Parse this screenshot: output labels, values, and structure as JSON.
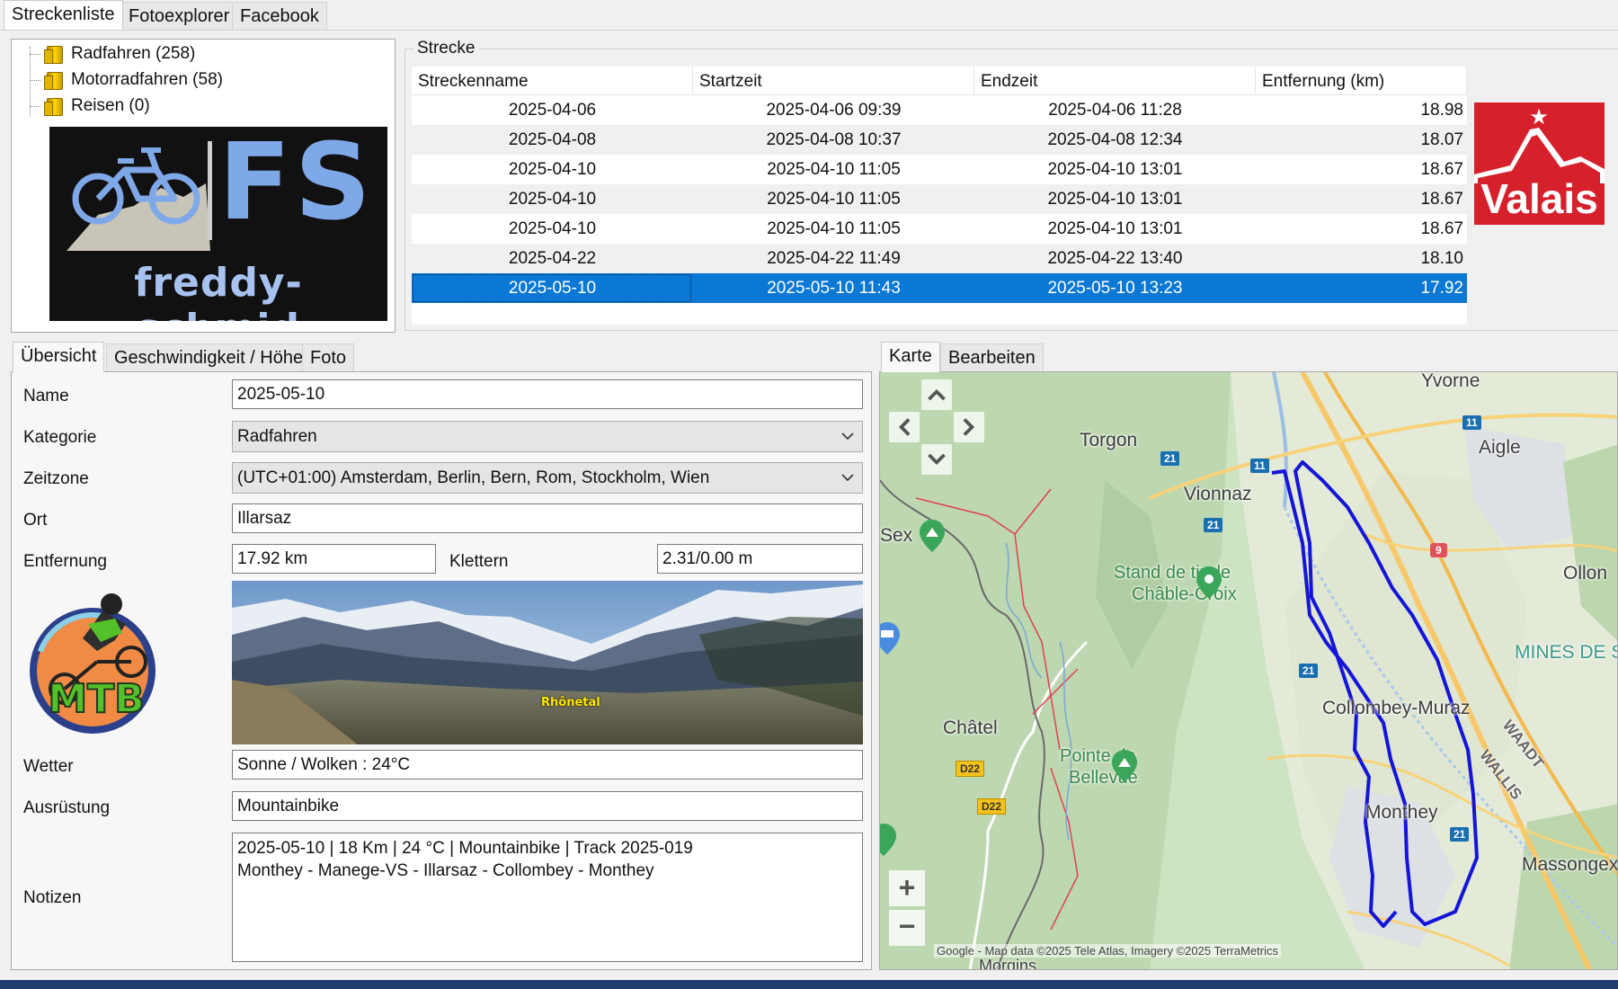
{
  "top_tabs": [
    "Streckenliste",
    "Fotoexplorer",
    "Facebook"
  ],
  "tree": [
    {
      "label": "Radfahren (258)"
    },
    {
      "label": "Motorradfahren (58)"
    },
    {
      "label": "Reisen (0)"
    }
  ],
  "logo_fs": {
    "main": "FS",
    "sub": "freddy-schmid"
  },
  "strecke": {
    "legend": "Strecke",
    "columns": [
      "Streckenname",
      "Startzeit",
      "Endzeit",
      "Entfernung (km)"
    ],
    "rows": [
      {
        "name": "2025-04-06",
        "start": "2025-04-06 09:39",
        "end": "2025-04-06 11:28",
        "dist": "18.98"
      },
      {
        "name": "2025-04-08",
        "start": "2025-04-08 10:37",
        "end": "2025-04-08 12:34",
        "dist": "18.07"
      },
      {
        "name": "2025-04-10",
        "start": "2025-04-10 11:05",
        "end": "2025-04-10 13:01",
        "dist": "18.67"
      },
      {
        "name": "2025-04-10",
        "start": "2025-04-10 11:05",
        "end": "2025-04-10 13:01",
        "dist": "18.67"
      },
      {
        "name": "2025-04-10",
        "start": "2025-04-10 11:05",
        "end": "2025-04-10 13:01",
        "dist": "18.67"
      },
      {
        "name": "2025-04-22",
        "start": "2025-04-22 11:49",
        "end": "2025-04-22 13:40",
        "dist": "18.10"
      },
      {
        "name": "2025-05-10",
        "start": "2025-05-10 11:43",
        "end": "2025-05-10 13:23",
        "dist": "17.92"
      }
    ],
    "selected_index": 6
  },
  "valais_logo": {
    "text": "Valais",
    "color": "#d6202b"
  },
  "detail_tabs": [
    "Übersicht",
    "Geschwindigkeit / Höhe",
    "Foto"
  ],
  "form": {
    "name_label": "Name",
    "name_value": "2025-05-10",
    "kategorie_label": "Kategorie",
    "kategorie_value": "Radfahren",
    "zeitzone_label": "Zeitzone",
    "zeitzone_value": "(UTC+01:00) Amsterdam, Berlin, Bern, Rom, Stockholm, Wien",
    "ort_label": "Ort",
    "ort_value": "Illarsaz",
    "entfernung_label": "Entfernung",
    "entfernung_value": "17.92 km",
    "klettern_label": "Klettern",
    "klettern_value": "2.31/0.00 m",
    "photo_caption": "Rhônetal",
    "wetter_label": "Wetter",
    "wetter_value": "Sonne / Wolken  :  24°C",
    "ausruestung_label": "Ausrüstung",
    "ausruestung_value": "Mountainbike",
    "notizen_label": "Notizen",
    "notizen_line1": "2025-05-10  |  18 Km  |  24 °C  |  Mountainbike  |  Track 2025-019",
    "notizen_line2": "Monthey - Manege-VS - Illarsaz - Collombey - Monthey"
  },
  "mtb_logo": {
    "text": "MTB"
  },
  "map_tabs": [
    "Karte",
    "Bearbeiten"
  ],
  "map": {
    "places": [
      "Yvorne",
      "Aigle",
      "Torgon",
      "Vionnaz",
      "Sex",
      "Stand de tir de",
      "Châble-Croix",
      "Ollon",
      "MINES DE S",
      "Collombey-Muraz",
      "Châtel",
      "Pointe de",
      "Bellevue",
      "Monthey",
      "Massongex",
      "WAADT",
      "WALLIS",
      "Morgins"
    ],
    "attribution": "Google - Map data ©2025 Tele Atlas, Imagery ©2025 TerraMetrics",
    "shields_blue": [
      "11",
      "21",
      "11",
      "21",
      "21",
      "21"
    ],
    "shields_yellow": [
      "D22",
      "D22"
    ],
    "highway_badge": "9",
    "zoom_in": "+",
    "zoom_out": "−",
    "route_color": "#1515d8"
  }
}
